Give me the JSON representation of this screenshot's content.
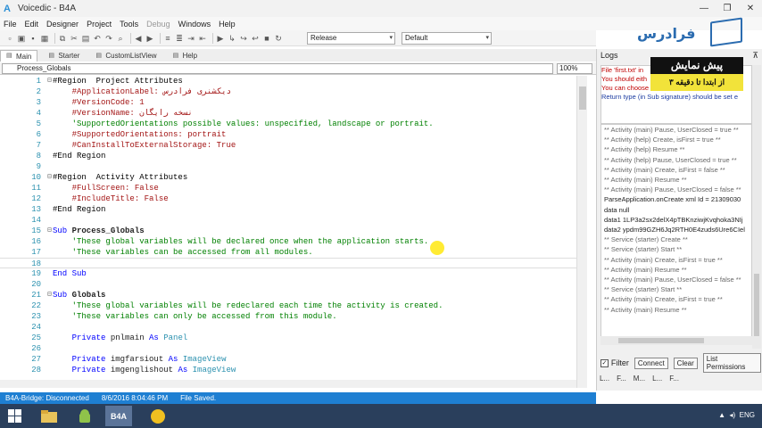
{
  "window": {
    "title": "Voicedic - B4A"
  },
  "menu": [
    "File",
    "Edit",
    "Designer",
    "Project",
    "Tools",
    "Debug",
    "Windows",
    "Help"
  ],
  "toolbar": {
    "build_config": "Release",
    "device": "Default"
  },
  "tabs": [
    "Main",
    "Starter",
    "CustomListView",
    "Help"
  ],
  "module_select": "Process_Globals",
  "zoom": "100%",
  "code_lines": [
    {
      "n": "1",
      "f": "⊟",
      "html": "<span class='p'>#Region  Project Attributes</span>"
    },
    {
      "n": "2",
      "f": "",
      "html": "    <span class='d'>#ApplicationLabel: دیکشنری فرادرس</span>"
    },
    {
      "n": "3",
      "f": "",
      "html": "    <span class='d'>#VersionCode: 1</span>"
    },
    {
      "n": "4",
      "f": "",
      "html": "    <span class='d'>#VersionName: نسخه رایگان</span>"
    },
    {
      "n": "5",
      "f": "",
      "html": "    <span class='c'>'SupportedOrientations possible values: unspecified, landscape or portrait.</span>"
    },
    {
      "n": "6",
      "f": "",
      "html": "    <span class='d'>#SupportedOrientations: portrait</span>"
    },
    {
      "n": "7",
      "f": "",
      "html": "    <span class='d'>#CanInstallToExternalStorage: True</span>"
    },
    {
      "n": "8",
      "f": "",
      "html": "<span class='p'>#End Region</span>"
    },
    {
      "n": "9",
      "f": "",
      "html": ""
    },
    {
      "n": "10",
      "f": "⊟",
      "html": "<span class='p'>#Region  Activity Attributes</span>"
    },
    {
      "n": "11",
      "f": "",
      "html": "    <span class='d'>#FullScreen: False</span>"
    },
    {
      "n": "12",
      "f": "",
      "html": "    <span class='d'>#IncludeTitle: False</span>"
    },
    {
      "n": "13",
      "f": "",
      "html": "<span class='p'>#End Region</span>"
    },
    {
      "n": "14",
      "f": "",
      "html": ""
    },
    {
      "n": "15",
      "f": "⊟",
      "html": "<span class='k'>Sub</span> <span class='b'>Process_Globals</span>"
    },
    {
      "n": "16",
      "f": "",
      "html": "    <span class='c'>'These global variables will be declared once when the application starts.</span>"
    },
    {
      "n": "17",
      "f": "",
      "html": "    <span class='c'>'These variables can be accessed from all modules.</span>"
    },
    {
      "n": "18",
      "f": "",
      "html": ""
    },
    {
      "n": "19",
      "f": "",
      "html": "<span class='k'>End Sub</span>"
    },
    {
      "n": "20",
      "f": "",
      "html": ""
    },
    {
      "n": "21",
      "f": "⊟",
      "html": "<span class='k'>Sub</span> <span class='b'>Globals</span>"
    },
    {
      "n": "22",
      "f": "",
      "html": "    <span class='c'>'These global variables will be redeclared each time the activity is created.</span>"
    },
    {
      "n": "23",
      "f": "",
      "html": "    <span class='c'>'These variables can only be accessed from this module.</span>"
    },
    {
      "n": "24",
      "f": "",
      "html": ""
    },
    {
      "n": "25",
      "f": "",
      "html": "    <span class='k'>Private</span> pnlmain <span class='k'>As</span> <span class='t'>Panel</span>"
    },
    {
      "n": "26",
      "f": "",
      "html": ""
    },
    {
      "n": "27",
      "f": "",
      "html": "    <span class='k'>Private</span> imgfarsiout <span class='k'>As</span> <span class='t'>ImageView</span>"
    },
    {
      "n": "28",
      "f": "",
      "html": "    <span class='k'>Private</span> imgenglishout <span class='k'>As</span> <span class='t'>ImageView</span>"
    }
  ],
  "status": {
    "bridge": "B4A-Bridge: Disconnected",
    "time": "8/6/2016 8:04:46 PM",
    "msg": "File Saved."
  },
  "logs": {
    "title": "Logs",
    "info": [
      "File 'first.txt' in",
      "You should eith",
      "You can choose",
      "Return type (in Sub signature) should be set e"
    ],
    "lines": [
      "** Activity (main) Pause, UserClosed = true **",
      "** Activity (help) Create, isFirst = true **",
      "** Activity (help) Resume **",
      "** Activity (help) Pause, UserClosed = true **",
      "** Activity (main) Create, isFirst = false **",
      "** Activity (main) Resume **",
      "** Activity (main) Pause, UserClosed = false **",
      "ParseApplication.onCreate xml Id = 21309030",
      "data null",
      "data1 1LP3a2sx2delX4pTBKnziwjKvqhoka3NIj",
      "data2 ypdm99GZH6Jq2RTH0E4zuds6Ure6CIel",
      "** Service (starter) Create **",
      "** Service (starter) Start **",
      "** Activity (main) Create, isFirst = true **",
      "** Activity (main) Resume **",
      "** Activity (main) Pause, UserClosed = false **",
      "** Service (starter) Start **",
      "** Activity (main) Create, isFirst = true **",
      "** Activity (main) Resume **"
    ],
    "filter": "Filter",
    "connect": "Connect",
    "clear": "Clear",
    "permissions": "List Permissions",
    "bottom_tabs": [
      "L...",
      "F...",
      "M...",
      "L...",
      "F..."
    ]
  },
  "brand": {
    "logo_text": "فرادرس",
    "promo_title": "پیش نمایش",
    "promo_sub": "از ابتدا تا دقیقه ۳"
  },
  "taskbar": {
    "lang": "ENG",
    "active_app": "B4A"
  }
}
